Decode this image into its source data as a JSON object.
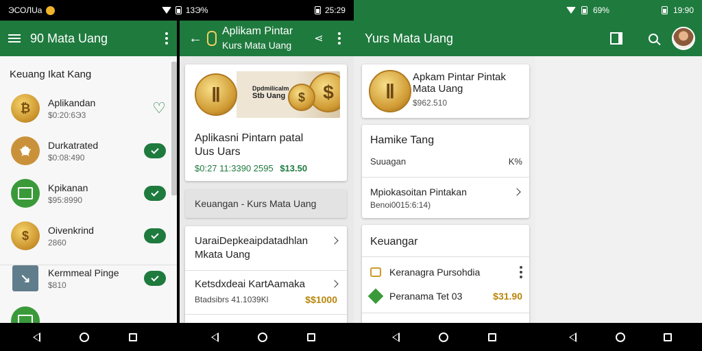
{
  "status_left": {
    "left_text": "ЭСОЛUа",
    "middle_text": "13Э%",
    "right_text": "25:29"
  },
  "status_right": {
    "battery_text": "69%",
    "time": "19:90"
  },
  "screen1": {
    "title": "90 Mata Uang",
    "section_title": "Keuang Ikat Kang",
    "items": [
      {
        "name": "Aplikandan",
        "sub": "$0:20:6Э3",
        "icon": "coin-icon",
        "action": "heart"
      },
      {
        "name": "Durkatrated",
        "sub": "$0:08:490",
        "icon": "star-coin-icon",
        "action": "pill"
      },
      {
        "name": "Kpikanan",
        "sub": "$95:8990",
        "icon": "wallet-icon",
        "action": "pill"
      },
      {
        "name": "Oivenkrind",
        "sub": "2860",
        "icon": "dollar-coin-icon",
        "action": "pill"
      },
      {
        "name": "Kermmeal Pinge",
        "sub": "$810",
        "icon": "chart-icon",
        "action": "pill"
      }
    ]
  },
  "screen2": {
    "title_line1": "Aplikam Pintar",
    "title_line2": "Kurs Mata Uang",
    "banner_text_line1": "Dpdmilicalm",
    "banner_text_line2": "Stb Uang",
    "card_title_line1": "Aplikasni Pintarn patal",
    "card_title_line2": "Uus Uars",
    "card_price": "$0:27 11:3390 2595",
    "card_price_gold": "$13.50",
    "section_label": "Keuangan - Kurs Mata Uang",
    "list": [
      {
        "title_line1": "UaraiDepkeaipdatadhlan",
        "title_line2": "Mkata Uang"
      },
      {
        "title_line1": "Ketsdxdeai KartAamaka",
        "sub": "Btadsibrs 41.1039Kl",
        "price": "$$1000"
      }
    ]
  },
  "screen3": {
    "title": "Yurs Mata Uang",
    "card1_title_line1": "Apkam Pintar Pintak",
    "card1_title_line2": "Mata Uang",
    "card1_sub": "$962.510",
    "card2_title": "Hamike Tang",
    "card2_row_label": "Suuagan",
    "card2_row_value": "K%",
    "card2_item_title": "Mpiokasoitan Pintakan",
    "card2_item_sub": "Benoi0015:6:14)",
    "card3_title": "Keuangar",
    "card3_rows": [
      {
        "label": "Keranagra Pursohdia",
        "value": ""
      },
      {
        "label": "Peranama Tet 03",
        "value": "$31.90"
      }
    ]
  },
  "colors": {
    "primary_green": "#1f7a3e",
    "gold": "#b8860b"
  }
}
